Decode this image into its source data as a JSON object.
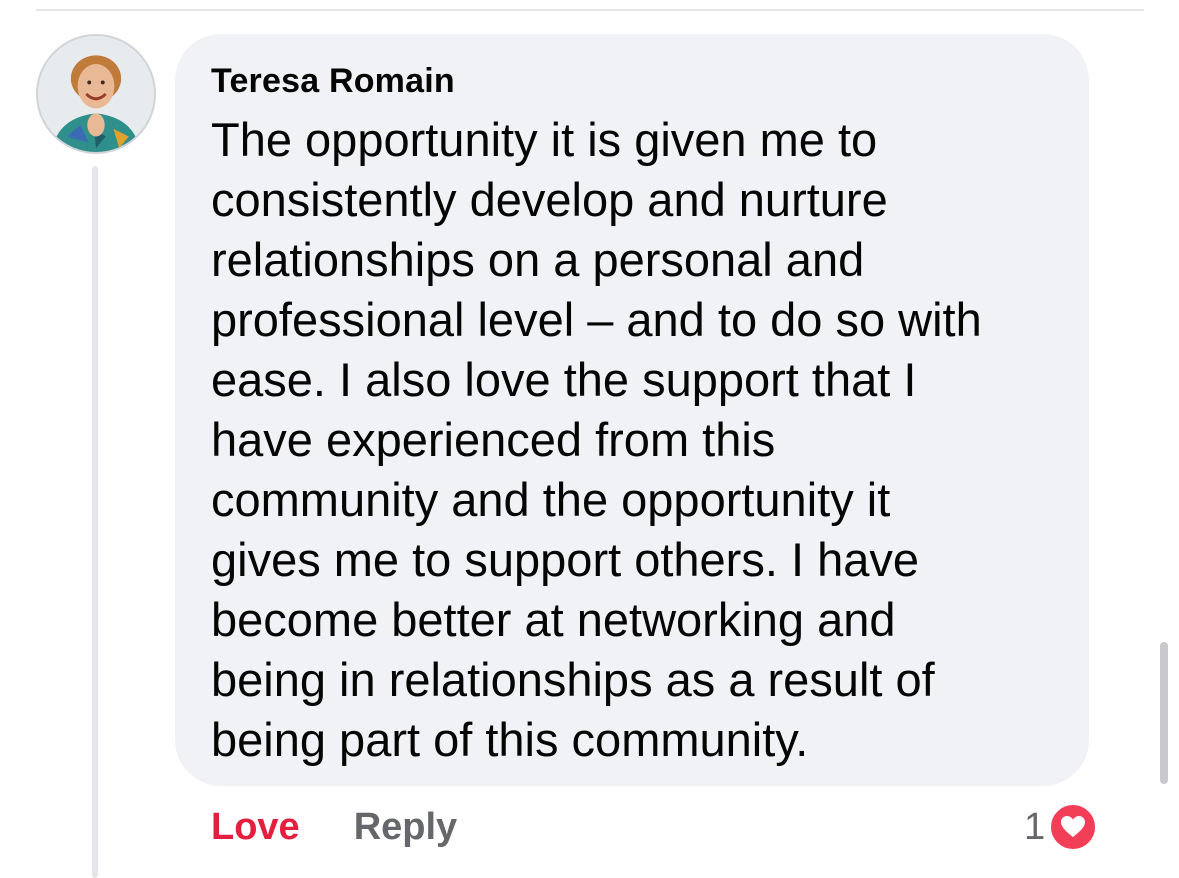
{
  "comment": {
    "author": "Teresa Romain",
    "text_lines": [
      "The opportunity it is given me to",
      "consistently develop and nurture",
      "relationships on a personal and",
      "professional level – and to do so with",
      "ease. I also love the support that I",
      "have experienced from this",
      "community and the opportunity it",
      "gives me to support others. I have",
      "become better at networking and",
      "being in relationships as a result of",
      "being part of this community."
    ],
    "avatar_icon": "profile-photo"
  },
  "actions": {
    "love_label": "Love",
    "reply_label": "Reply"
  },
  "reactions": {
    "count": "1",
    "icon": "heart-icon"
  },
  "colors": {
    "bubble": "#f0f2f5",
    "love": "#e41e3f",
    "muted": "#65676b",
    "heart": "#f33e58"
  }
}
